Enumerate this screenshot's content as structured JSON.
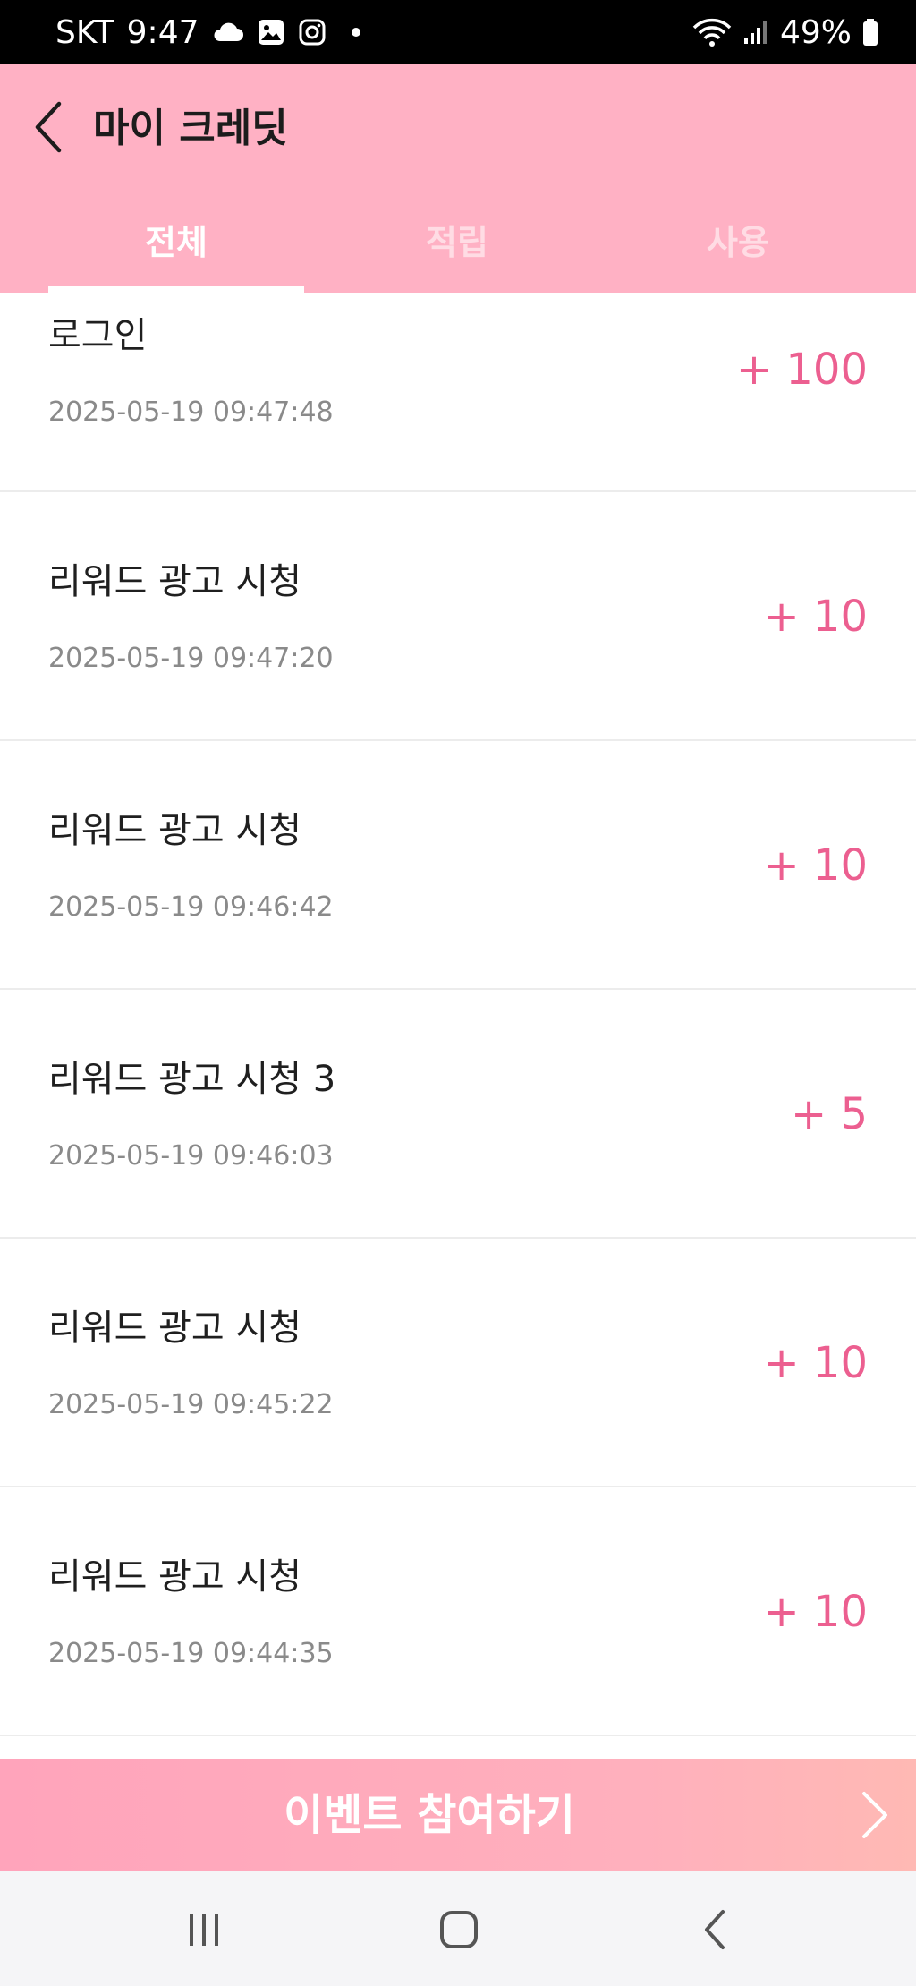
{
  "status_bar": {
    "carrier": "SKT",
    "time": "9:47",
    "battery": "49%",
    "icons": [
      "cloud-icon",
      "gallery-icon",
      "instagram-icon",
      "notification-dot-icon",
      "wifi-icon",
      "signal-icon",
      "battery-icon"
    ]
  },
  "header": {
    "title": "마이 크레딧",
    "back_icon": "chevron-left-icon"
  },
  "tabs": [
    {
      "label": "전체",
      "active": true
    },
    {
      "label": "적립",
      "active": false
    },
    {
      "label": "사용",
      "active": false
    }
  ],
  "list": [
    {
      "title": "로그인",
      "date": "2025-05-19 09:47:48",
      "amount": "+ 100"
    },
    {
      "title": "리워드 광고 시청",
      "date": "2025-05-19 09:47:20",
      "amount": "+ 10"
    },
    {
      "title": "리워드 광고 시청",
      "date": "2025-05-19 09:46:42",
      "amount": "+ 10"
    },
    {
      "title": "리워드 광고 시청 3",
      "date": "2025-05-19 09:46:03",
      "amount": "+ 5"
    },
    {
      "title": "리워드 광고 시청",
      "date": "2025-05-19 09:45:22",
      "amount": "+ 10"
    },
    {
      "title": "리워드 광고 시청",
      "date": "2025-05-19 09:44:35",
      "amount": "+ 10"
    }
  ],
  "event_button": {
    "label": "이벤트 참여하기",
    "icon": "chevron-right-icon"
  },
  "nav_bar": {
    "icons": [
      "recent-apps-icon",
      "home-icon",
      "back-icon"
    ]
  },
  "colors": {
    "header_bg": "#ffb1c4",
    "amount": "#ec5f90",
    "event_bg": "#ffb0bd"
  }
}
